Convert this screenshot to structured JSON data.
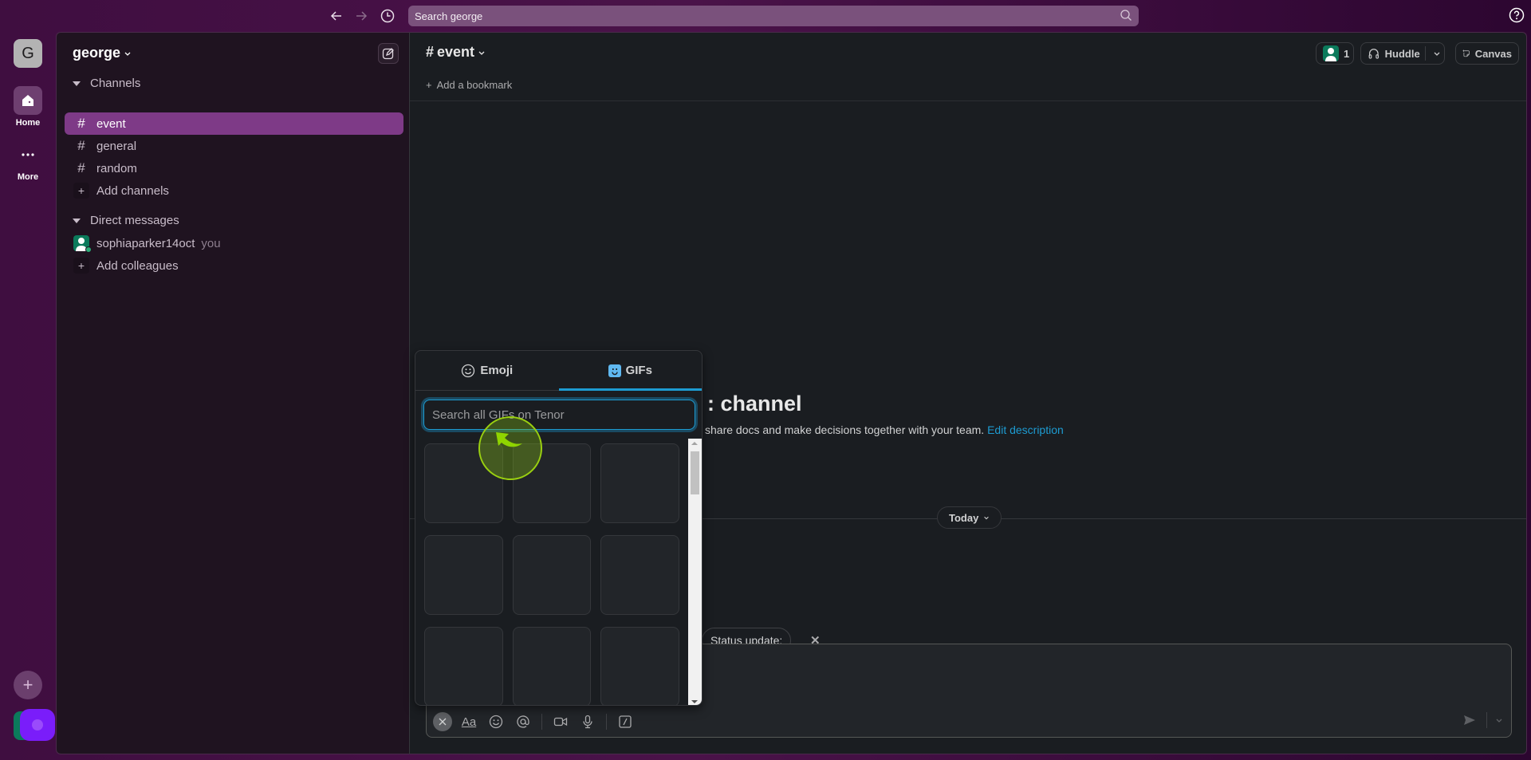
{
  "topbar": {
    "search_placeholder": "Search george",
    "icons": [
      "arrow-left-icon",
      "arrow-right-icon",
      "history-icon",
      "search-icon",
      "help-icon"
    ]
  },
  "rail": {
    "workspace_initial": "G",
    "home_label": "Home",
    "more_label": "More"
  },
  "sidebar": {
    "workspace_name": "george",
    "channels_header": "Channels",
    "channels": [
      {
        "name": "event",
        "active": true
      },
      {
        "name": "general",
        "active": false
      },
      {
        "name": "random",
        "active": false
      }
    ],
    "add_channels": "Add channels",
    "dm_header": "Direct messages",
    "dms": [
      {
        "name": "sophiaparker14oct",
        "tag": "you"
      }
    ],
    "add_colleagues": "Add colleagues"
  },
  "channel": {
    "title": "event",
    "add_bookmark": "Add a bookmark",
    "member_count": "1",
    "huddle_label": "Huddle",
    "canvas_label": "Canvas",
    "intro_title_visible": ": channel",
    "intro_desc_visible": "share docs and make decisions together with your team.",
    "edit_description": "Edit description",
    "date_divider": "Today",
    "status_update": "Status update:"
  },
  "picker": {
    "tabs": [
      {
        "label": "Emoji",
        "active": false
      },
      {
        "label": "GIFs",
        "active": true
      }
    ],
    "search_placeholder": "Search all GIFs on Tenor",
    "search_value": "",
    "gif_cell_count": 9
  },
  "colors": {
    "accent_blue": "#1d9bd1",
    "active_channel": "#7e3a87",
    "aubergine": "#3f0e40"
  }
}
